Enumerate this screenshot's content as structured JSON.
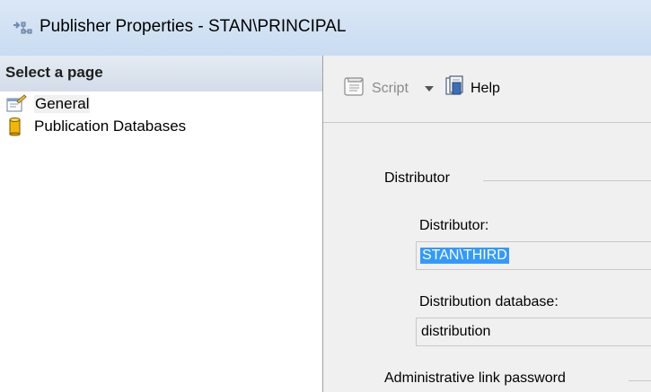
{
  "window": {
    "title": "Publisher Properties - STAN\\PRINCIPAL"
  },
  "left_pane": {
    "header": "Select a page",
    "items": [
      {
        "label": "General",
        "icon": "general-page-icon",
        "selected": true
      },
      {
        "label": "Publication Databases",
        "icon": "database-icon",
        "selected": false
      }
    ]
  },
  "toolbar": {
    "script_label": "Script",
    "help_label": "Help"
  },
  "distributor_group": {
    "label": "Distributor",
    "distributor_label": "Distributor:",
    "distributor_value": "STAN\\THIRD",
    "distribution_db_label": "Distribution database:",
    "distribution_db_value": "distribution"
  },
  "admin_group": {
    "label": "Administrative link password"
  },
  "colors": {
    "titlebar": "#d5e4f4",
    "selection": "#3399ff",
    "panel_bg": "#f0f0f0"
  }
}
